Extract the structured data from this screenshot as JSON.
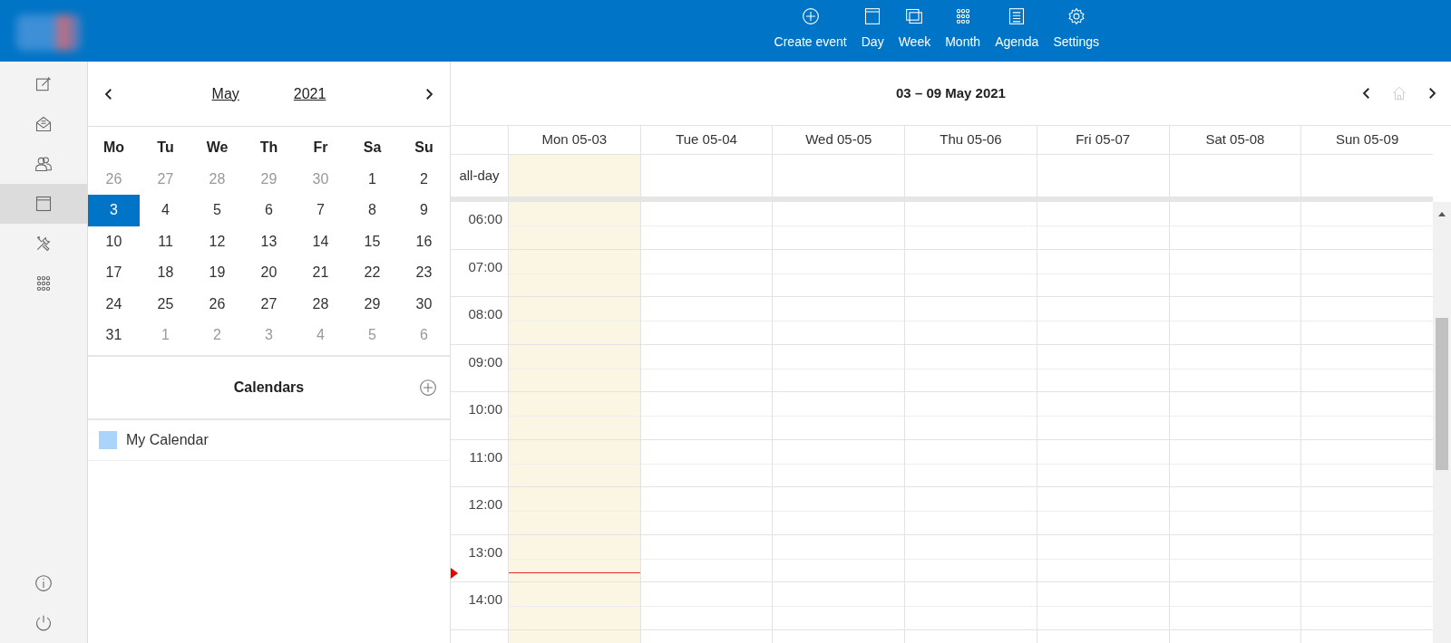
{
  "topbar": {
    "actions": [
      {
        "kind": "create",
        "label": "Create event"
      },
      {
        "kind": "day",
        "label": "Day"
      },
      {
        "kind": "week",
        "label": "Week"
      },
      {
        "kind": "month",
        "label": "Month"
      },
      {
        "kind": "agenda",
        "label": "Agenda"
      },
      {
        "kind": "settings",
        "label": "Settings"
      }
    ]
  },
  "rail": {
    "items": [
      {
        "kind": "compose",
        "selected": false
      },
      {
        "kind": "mail",
        "selected": false
      },
      {
        "kind": "contacts",
        "selected": false
      },
      {
        "kind": "calendar",
        "selected": true
      },
      {
        "kind": "tools",
        "selected": false
      },
      {
        "kind": "apps",
        "selected": false
      }
    ],
    "bottom_items": [
      {
        "kind": "info"
      },
      {
        "kind": "power"
      }
    ]
  },
  "mini_calendar": {
    "month": "May",
    "year": "2021",
    "weekdays": [
      "Mo",
      "Tu",
      "We",
      "Th",
      "Fr",
      "Sa",
      "Su"
    ],
    "weeks": [
      [
        {
          "day": "26",
          "outside": true,
          "selected": false
        },
        {
          "day": "27",
          "outside": true,
          "selected": false
        },
        {
          "day": "28",
          "outside": true,
          "selected": false
        },
        {
          "day": "29",
          "outside": true,
          "selected": false
        },
        {
          "day": "30",
          "outside": true,
          "selected": false
        },
        {
          "day": "1",
          "outside": false,
          "selected": false
        },
        {
          "day": "2",
          "outside": false,
          "selected": false
        }
      ],
      [
        {
          "day": "3",
          "outside": false,
          "selected": true
        },
        {
          "day": "4",
          "outside": false,
          "selected": false
        },
        {
          "day": "5",
          "outside": false,
          "selected": false
        },
        {
          "day": "6",
          "outside": false,
          "selected": false
        },
        {
          "day": "7",
          "outside": false,
          "selected": false
        },
        {
          "day": "8",
          "outside": false,
          "selected": false
        },
        {
          "day": "9",
          "outside": false,
          "selected": false
        }
      ],
      [
        {
          "day": "10",
          "outside": false,
          "selected": false
        },
        {
          "day": "11",
          "outside": false,
          "selected": false
        },
        {
          "day": "12",
          "outside": false,
          "selected": false
        },
        {
          "day": "13",
          "outside": false,
          "selected": false
        },
        {
          "day": "14",
          "outside": false,
          "selected": false
        },
        {
          "day": "15",
          "outside": false,
          "selected": false
        },
        {
          "day": "16",
          "outside": false,
          "selected": false
        }
      ],
      [
        {
          "day": "17",
          "outside": false,
          "selected": false
        },
        {
          "day": "18",
          "outside": false,
          "selected": false
        },
        {
          "day": "19",
          "outside": false,
          "selected": false
        },
        {
          "day": "20",
          "outside": false,
          "selected": false
        },
        {
          "day": "21",
          "outside": false,
          "selected": false
        },
        {
          "day": "22",
          "outside": false,
          "selected": false
        },
        {
          "day": "23",
          "outside": false,
          "selected": false
        }
      ],
      [
        {
          "day": "24",
          "outside": false,
          "selected": false
        },
        {
          "day": "25",
          "outside": false,
          "selected": false
        },
        {
          "day": "26",
          "outside": false,
          "selected": false
        },
        {
          "day": "27",
          "outside": false,
          "selected": false
        },
        {
          "day": "28",
          "outside": false,
          "selected": false
        },
        {
          "day": "29",
          "outside": false,
          "selected": false
        },
        {
          "day": "30",
          "outside": false,
          "selected": false
        }
      ],
      [
        {
          "day": "31",
          "outside": false,
          "selected": false
        },
        {
          "day": "1",
          "outside": true,
          "selected": false
        },
        {
          "day": "2",
          "outside": true,
          "selected": false
        },
        {
          "day": "3",
          "outside": true,
          "selected": false
        },
        {
          "day": "4",
          "outside": true,
          "selected": false
        },
        {
          "day": "5",
          "outside": true,
          "selected": false
        },
        {
          "day": "6",
          "outside": true,
          "selected": false
        }
      ]
    ]
  },
  "calendars": {
    "title": "Calendars",
    "items": [
      {
        "name": "My Calendar",
        "color": "#aad4fa"
      }
    ]
  },
  "week_view": {
    "title": "03 – 09 May 2021",
    "nav": [
      {
        "kind": "prev",
        "disabled": false
      },
      {
        "kind": "home",
        "disabled": true
      },
      {
        "kind": "next",
        "disabled": false
      }
    ],
    "days": [
      {
        "label": "Mon 05-03",
        "today": true
      },
      {
        "label": "Tue 05-04",
        "today": false
      },
      {
        "label": "Wed 05-05",
        "today": false
      },
      {
        "label": "Thu 05-06",
        "today": false
      },
      {
        "label": "Fri 05-07",
        "today": false
      },
      {
        "label": "Sat 05-08",
        "today": false
      },
      {
        "label": "Sun 05-09",
        "today": false
      }
    ],
    "all_day_label": "all-day",
    "hours": [
      "06:00",
      "07:00",
      "08:00",
      "09:00",
      "10:00",
      "11:00",
      "12:00",
      "13:00",
      "14:00"
    ]
  }
}
